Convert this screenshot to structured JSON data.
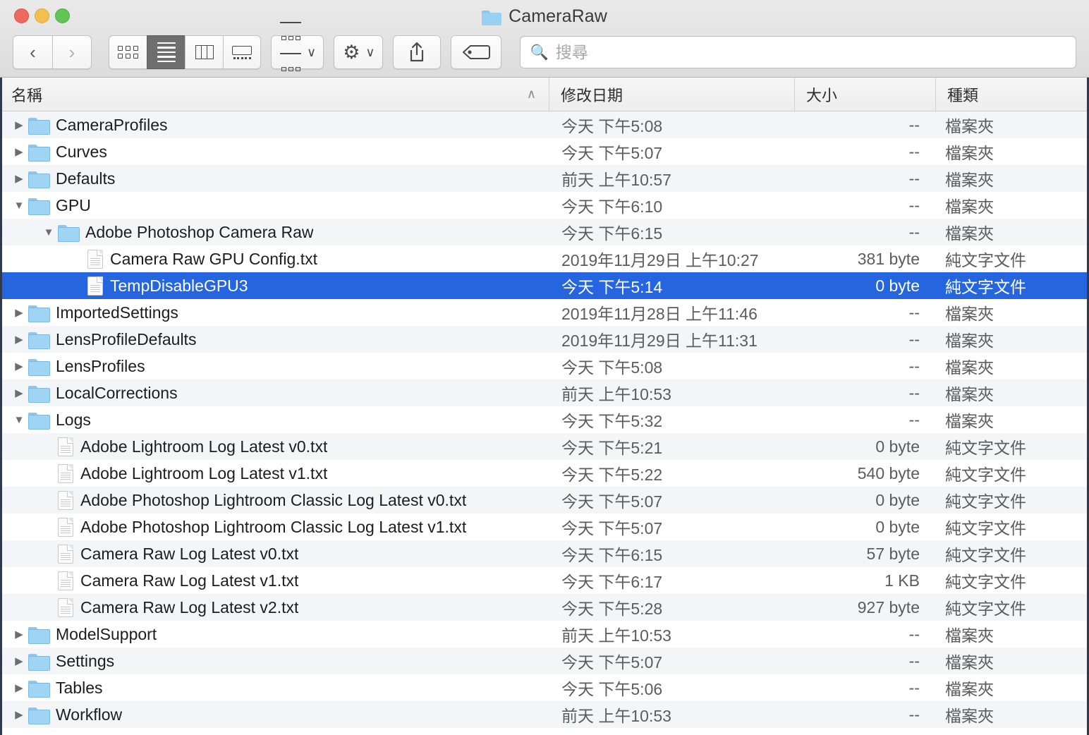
{
  "window": {
    "title": "CameraRaw",
    "traffic_lights": [
      {
        "name": "close",
        "color": "#ec6a5f"
      },
      {
        "name": "minimize",
        "color": "#f3bf4f"
      },
      {
        "name": "zoom",
        "color": "#61c554"
      }
    ]
  },
  "toolbar": {
    "back_label": "‹",
    "forward_label": "›",
    "view_buttons": [
      {
        "name": "icon-view",
        "active": false
      },
      {
        "name": "list-view",
        "active": true
      },
      {
        "name": "column-view",
        "active": false
      },
      {
        "name": "coverflow-view",
        "active": false
      }
    ],
    "arrange_caret": "∨",
    "action_caret": "∨",
    "gear_glyph": "⚙",
    "share_glyph": "⤴",
    "search": {
      "placeholder": "搜尋",
      "value": "",
      "icon": "search-icon"
    }
  },
  "columns": {
    "name": "名稱",
    "date": "修改日期",
    "size": "大小",
    "kind": "種類",
    "sort_indicator": "∧"
  },
  "kinds": {
    "folder": "檔案夾",
    "text": "純文字文件"
  },
  "rows": [
    {
      "name": "CameraProfiles",
      "date": "今天 下午5:08",
      "size": "--",
      "kind": "檔案夾",
      "type": "folder",
      "indent": 0,
      "twisty": "collapsed",
      "selected": false
    },
    {
      "name": "Curves",
      "date": "今天 下午5:07",
      "size": "--",
      "kind": "檔案夾",
      "type": "folder",
      "indent": 0,
      "twisty": "collapsed",
      "selected": false
    },
    {
      "name": "Defaults",
      "date": "前天 上午10:57",
      "size": "--",
      "kind": "檔案夾",
      "type": "folder",
      "indent": 0,
      "twisty": "collapsed",
      "selected": false
    },
    {
      "name": "GPU",
      "date": "今天 下午6:10",
      "size": "--",
      "kind": "檔案夾",
      "type": "folder",
      "indent": 0,
      "twisty": "expanded",
      "selected": false
    },
    {
      "name": "Adobe Photoshop Camera Raw",
      "date": "今天 下午6:15",
      "size": "--",
      "kind": "檔案夾",
      "type": "folder",
      "indent": 1,
      "twisty": "expanded",
      "selected": false
    },
    {
      "name": "Camera Raw GPU Config.txt",
      "date": "2019年11月29日 上午10:27",
      "size": "381 byte",
      "kind": "純文字文件",
      "type": "doc",
      "indent": 2,
      "twisty": "none",
      "selected": false
    },
    {
      "name": "TempDisableGPU3",
      "date": "今天 下午5:14",
      "size": "0 byte",
      "kind": "純文字文件",
      "type": "doc",
      "indent": 2,
      "twisty": "none",
      "selected": true
    },
    {
      "name": "ImportedSettings",
      "date": "2019年11月28日 上午11:46",
      "size": "--",
      "kind": "檔案夾",
      "type": "folder",
      "indent": 0,
      "twisty": "collapsed",
      "selected": false
    },
    {
      "name": "LensProfileDefaults",
      "date": "2019年11月29日 上午11:31",
      "size": "--",
      "kind": "檔案夾",
      "type": "folder",
      "indent": 0,
      "twisty": "collapsed",
      "selected": false
    },
    {
      "name": "LensProfiles",
      "date": "今天 下午5:08",
      "size": "--",
      "kind": "檔案夾",
      "type": "folder",
      "indent": 0,
      "twisty": "collapsed",
      "selected": false
    },
    {
      "name": "LocalCorrections",
      "date": "前天 上午10:53",
      "size": "--",
      "kind": "檔案夾",
      "type": "folder",
      "indent": 0,
      "twisty": "collapsed",
      "selected": false
    },
    {
      "name": "Logs",
      "date": "今天 下午5:32",
      "size": "--",
      "kind": "檔案夾",
      "type": "folder",
      "indent": 0,
      "twisty": "expanded",
      "selected": false
    },
    {
      "name": "Adobe Lightroom Log Latest v0.txt",
      "date": "今天 下午5:21",
      "size": "0 byte",
      "kind": "純文字文件",
      "type": "doc",
      "indent": 1,
      "twisty": "none",
      "selected": false
    },
    {
      "name": "Adobe Lightroom Log Latest v1.txt",
      "date": "今天 下午5:22",
      "size": "540 byte",
      "kind": "純文字文件",
      "type": "doc",
      "indent": 1,
      "twisty": "none",
      "selected": false
    },
    {
      "name": "Adobe Photoshop Lightroom Classic Log Latest v0.txt",
      "date": "今天 下午5:07",
      "size": "0 byte",
      "kind": "純文字文件",
      "type": "doc",
      "indent": 1,
      "twisty": "none",
      "selected": false
    },
    {
      "name": "Adobe Photoshop Lightroom Classic Log Latest v1.txt",
      "date": "今天 下午5:07",
      "size": "0 byte",
      "kind": "純文字文件",
      "type": "doc",
      "indent": 1,
      "twisty": "none",
      "selected": false
    },
    {
      "name": "Camera Raw Log Latest v0.txt",
      "date": "今天 下午6:15",
      "size": "57 byte",
      "kind": "純文字文件",
      "type": "doc",
      "indent": 1,
      "twisty": "none",
      "selected": false
    },
    {
      "name": "Camera Raw Log Latest v1.txt",
      "date": "今天 下午6:17",
      "size": "1 KB",
      "kind": "純文字文件",
      "type": "doc",
      "indent": 1,
      "twisty": "none",
      "selected": false
    },
    {
      "name": "Camera Raw Log Latest v2.txt",
      "date": "今天 下午5:28",
      "size": "927 byte",
      "kind": "純文字文件",
      "type": "doc",
      "indent": 1,
      "twisty": "none",
      "selected": false
    },
    {
      "name": "ModelSupport",
      "date": "前天 上午10:53",
      "size": "--",
      "kind": "檔案夾",
      "type": "folder",
      "indent": 0,
      "twisty": "collapsed",
      "selected": false
    },
    {
      "name": "Settings",
      "date": "今天 下午5:07",
      "size": "--",
      "kind": "檔案夾",
      "type": "folder",
      "indent": 0,
      "twisty": "collapsed",
      "selected": false
    },
    {
      "name": "Tables",
      "date": "今天 下午5:06",
      "size": "--",
      "kind": "檔案夾",
      "type": "folder",
      "indent": 0,
      "twisty": "collapsed",
      "selected": false
    },
    {
      "name": "Workflow",
      "date": "前天 上午10:53",
      "size": "--",
      "kind": "檔案夾",
      "type": "folder",
      "indent": 0,
      "twisty": "collapsed",
      "selected": false
    }
  ],
  "colors": {
    "selection": "#2566e0",
    "stripe": "#f4f5f7",
    "folder_icon": "#a0d4f5"
  }
}
